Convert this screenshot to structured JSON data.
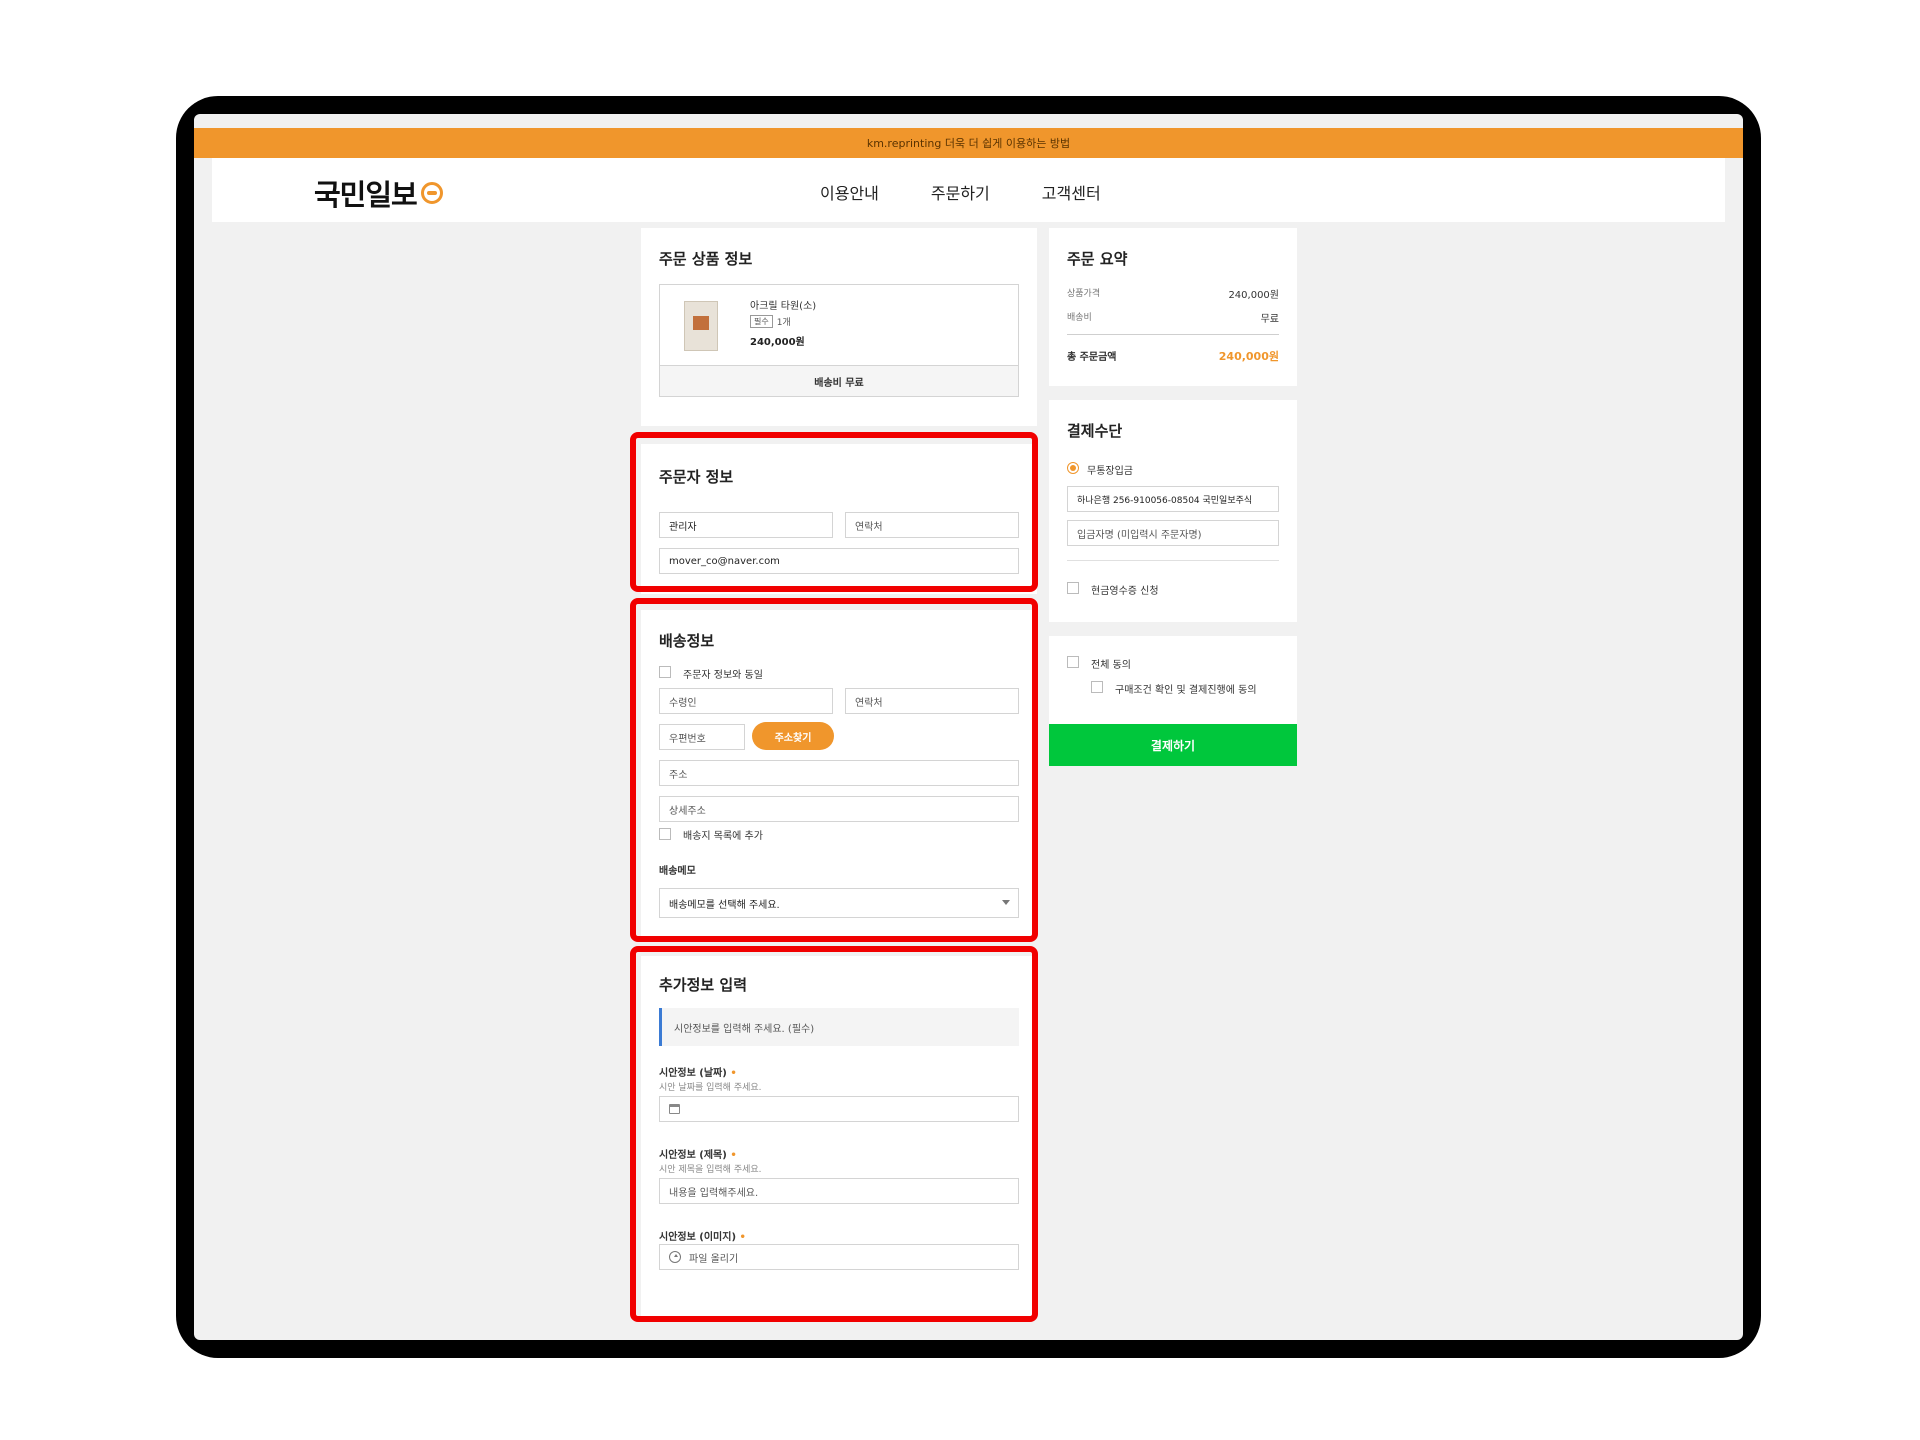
{
  "announcement": "km.reprinting 더욱 더 쉽게 이용하는 방법",
  "header": {
    "logo_text": "국민일보",
    "nav": [
      "이용안내",
      "주문하기",
      "고객센터"
    ]
  },
  "product": {
    "title": "주문 상품 정보",
    "name": "아크릴 타원(소)",
    "qty_badge": "필수",
    "qty": "1개",
    "price": "240,000원",
    "shipping": "배송비 무료"
  },
  "orderer": {
    "title": "주문자 정보",
    "name_value": "관리자",
    "phone_placeholder": "연락처",
    "email_value": "mover_co@naver.com"
  },
  "delivery": {
    "title": "배송정보",
    "same_as_orderer": "주문자 정보와 동일",
    "recipient_placeholder": "수령인",
    "phone_placeholder": "연락처",
    "zip_placeholder": "우편번호",
    "find_address_button": "주소찾기",
    "address_placeholder": "주소",
    "detail_placeholder": "상세주소",
    "add_to_list": "배송지 목록에 추가",
    "memo_label": "배송메모",
    "memo_select": "배송메모를 선택해 주세요."
  },
  "extra": {
    "title": "추가정보 입력",
    "notice": "시안정보를 입력해 주세요. (필수)",
    "date_label": "시안정보 (날짜)",
    "date_hint": "시안 날짜를 입력해 주세요.",
    "subject_label": "시안정보 (제목)",
    "subject_hint": "시안 제목을 입력해 주세요.",
    "subject_placeholder": "내용을 입력해주세요.",
    "image_label": "시안정보 (이미지)",
    "upload_label": "파일 올리기",
    "required_mark": "•"
  },
  "summary": {
    "title": "주문 요약",
    "price_label": "상품가격",
    "price_value": "240,000원",
    "shipping_label": "배송비",
    "shipping_value": "무료",
    "total_label": "총 주문금액",
    "total_value": "240,000원"
  },
  "payment": {
    "title": "결제수단",
    "method": "무통장입금",
    "account": "하나은행 256-910056-08504 국민일보주식",
    "depositor_placeholder": "입금자명 (미입력시 주문자명)",
    "cash_receipt": "현금영수증 신청"
  },
  "agreement": {
    "all": "전체 동의",
    "terms": "구매조건 확인 및 결제진행에 동의",
    "pay_button": "결제하기"
  },
  "colors": {
    "accent": "#f0962c",
    "pay_button": "#00c73c",
    "highlight": "#f10000"
  }
}
